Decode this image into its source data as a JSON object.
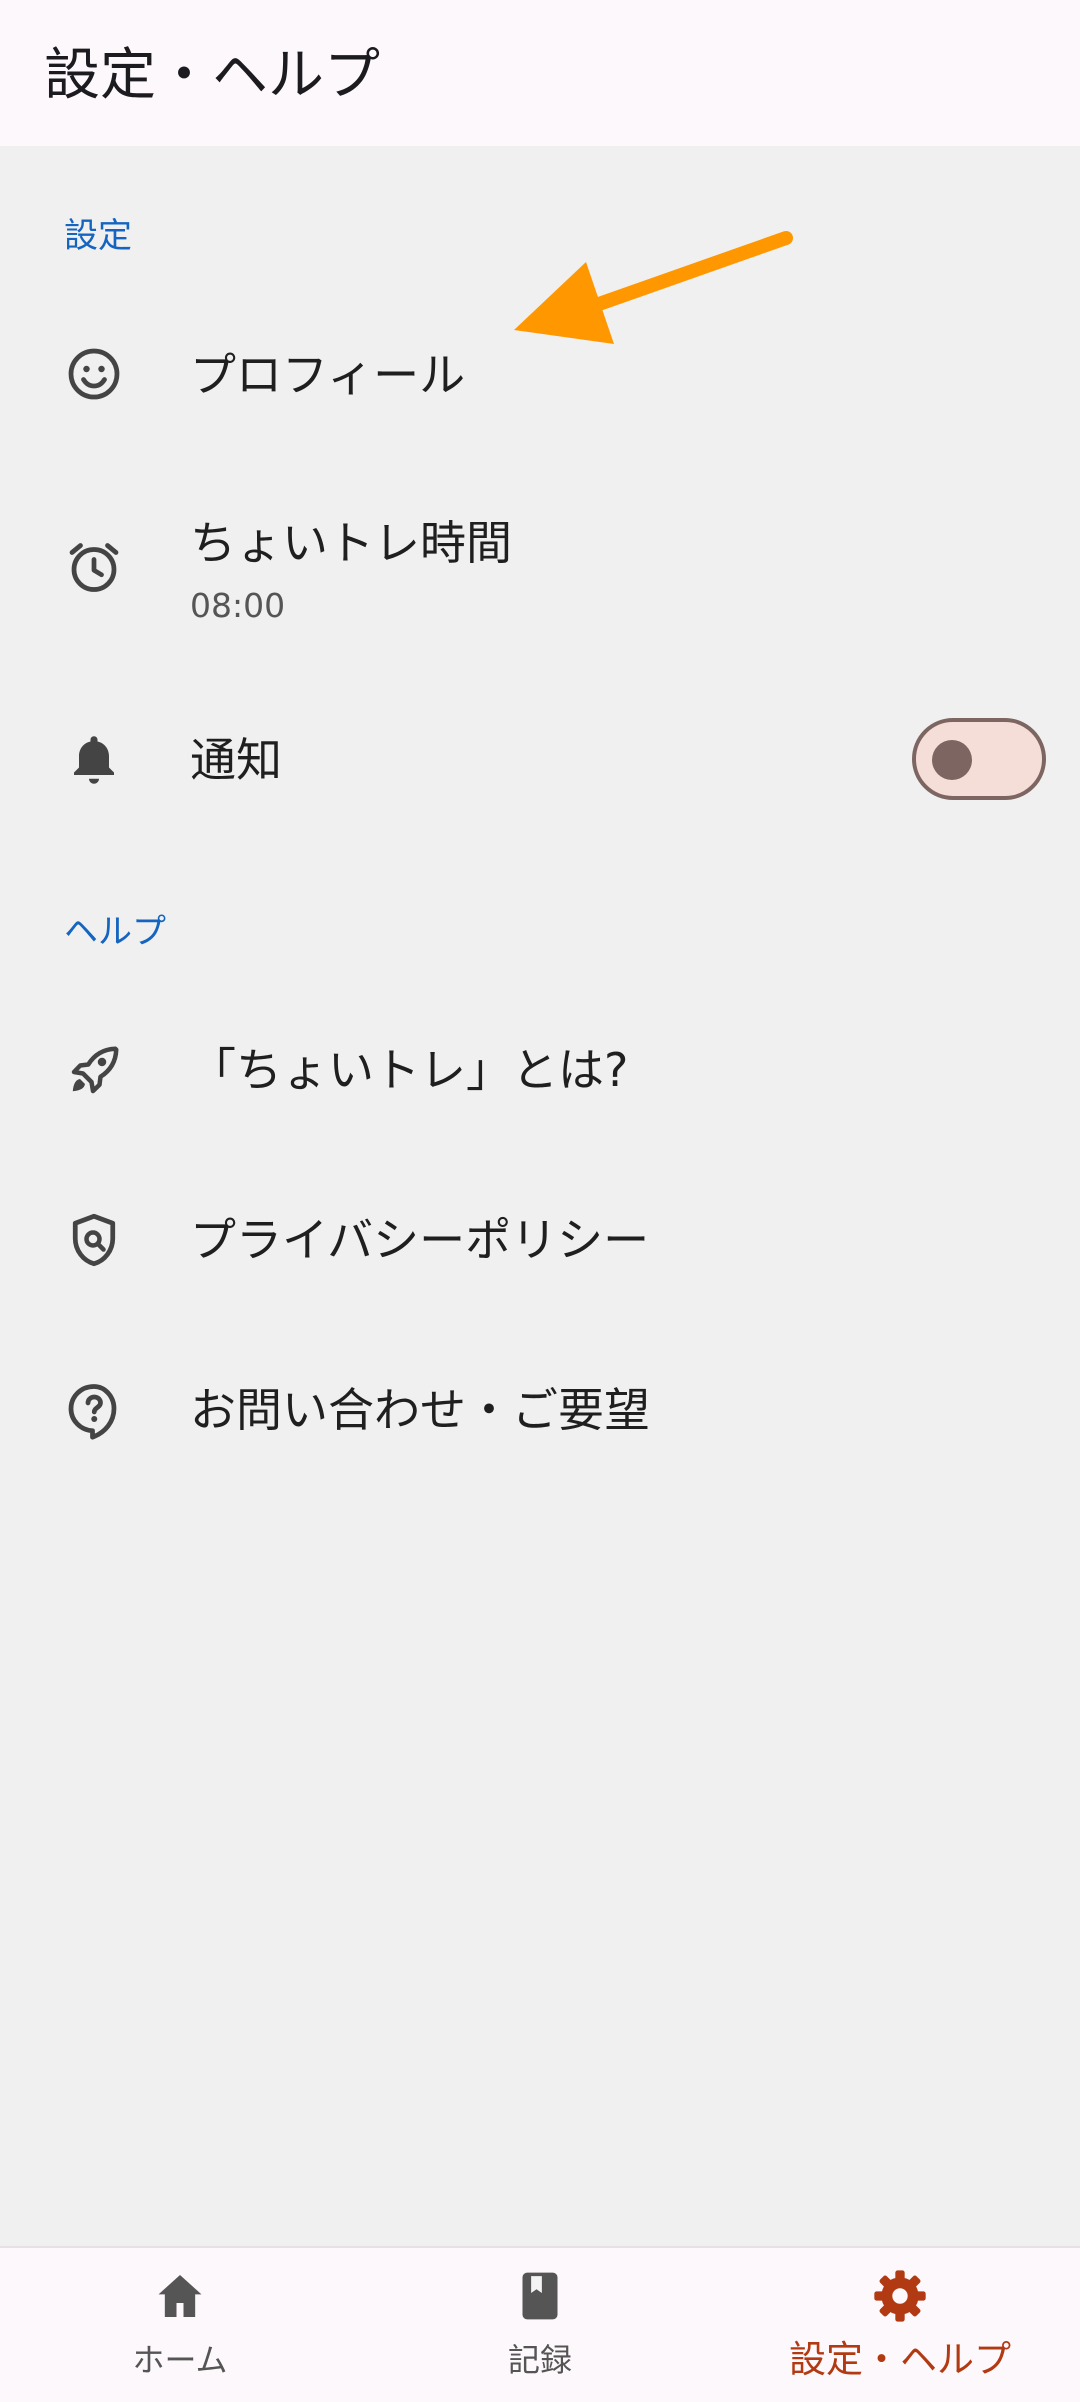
{
  "app_bar": {
    "title": "設定・ヘルプ"
  },
  "settings_section": {
    "header": "設定",
    "items": [
      {
        "label": "プロフィール",
        "icon": "smiley-face-icon"
      },
      {
        "label": "ちょいトレ時間",
        "sub": "08:00",
        "icon": "alarm-clock-icon"
      },
      {
        "label": "通知",
        "icon": "bell-icon",
        "toggle_on": false
      }
    ]
  },
  "help_section": {
    "header": "ヘルプ",
    "items": [
      {
        "label": "「ちょいトレ」とは?",
        "icon": "rocket-icon"
      },
      {
        "label": "プライバシーポリシー",
        "icon": "shield-person-icon"
      },
      {
        "label": "お問い合わせ・ご要望",
        "icon": "help-bubble-icon"
      }
    ]
  },
  "bottom_nav": {
    "items": [
      {
        "label": "ホーム",
        "icon": "home-icon",
        "active": false
      },
      {
        "label": "記録",
        "icon": "book-icon",
        "active": false
      },
      {
        "label": "設定・ヘルプ",
        "icon": "gear-icon",
        "active": true
      }
    ]
  },
  "colors": {
    "section_header": "#1565c0",
    "active_nav": "#b23a12",
    "annotation_arrow": "#ff9800",
    "toggle_track": "#f5ddd8",
    "toggle_border": "#7d6661",
    "background": "#f0f0f0",
    "bar_background": "#fdf8fb"
  }
}
